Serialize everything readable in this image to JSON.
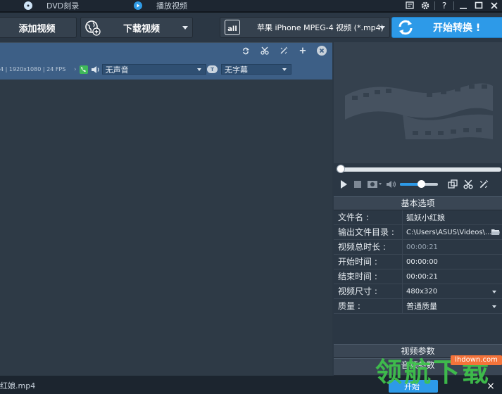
{
  "top_tabs": {
    "dvd_label": "DVD刻录",
    "play_label": "播放视频"
  },
  "window_controls": {
    "help": "?"
  },
  "toolbar": {
    "add_video": "添加视频",
    "download_video": "下载视频",
    "format_icon": "all",
    "format": "苹果 iPhone MPEG-4 视频 (*.mp4)",
    "convert": "开始转换 !"
  },
  "file_item": {
    "meta": "4 | 1920x1080 | 24 FPS",
    "audio": "无声音",
    "subtitle": "无字幕",
    "subtitle_icon": "T"
  },
  "bottom": {
    "filename": "红娘.mp4"
  },
  "player": {
    "seek_position": 0,
    "volume_level": 0.55
  },
  "settings": {
    "basic_title": "基本选项",
    "rows": [
      {
        "label": "文件名 :",
        "value": "狐妖小红娘"
      },
      {
        "label": "输出文件目录 :",
        "value": "C:\\Users\\ASUS\\Videos\\..."
      },
      {
        "label": "视频总时长 :",
        "value": "00:00:21"
      },
      {
        "label": "开始时间 :",
        "value": "00:00:00"
      },
      {
        "label": "结束时间 :",
        "value": "00:00:21"
      },
      {
        "label": "视频尺寸 :",
        "value": "480x320"
      },
      {
        "label": "质量 :",
        "value": "普通质量"
      }
    ],
    "video_params_title": "视频参数",
    "audio_params_title": "音频参数"
  },
  "watermark": {
    "text": "领航下载",
    "url": "lhdown.com"
  },
  "bottom_overlay": {
    "start": "开始",
    "close": "×"
  },
  "colors": {
    "accent": "#2d9ae8",
    "file_header": "#3d5f86",
    "background": "#2b3744"
  }
}
